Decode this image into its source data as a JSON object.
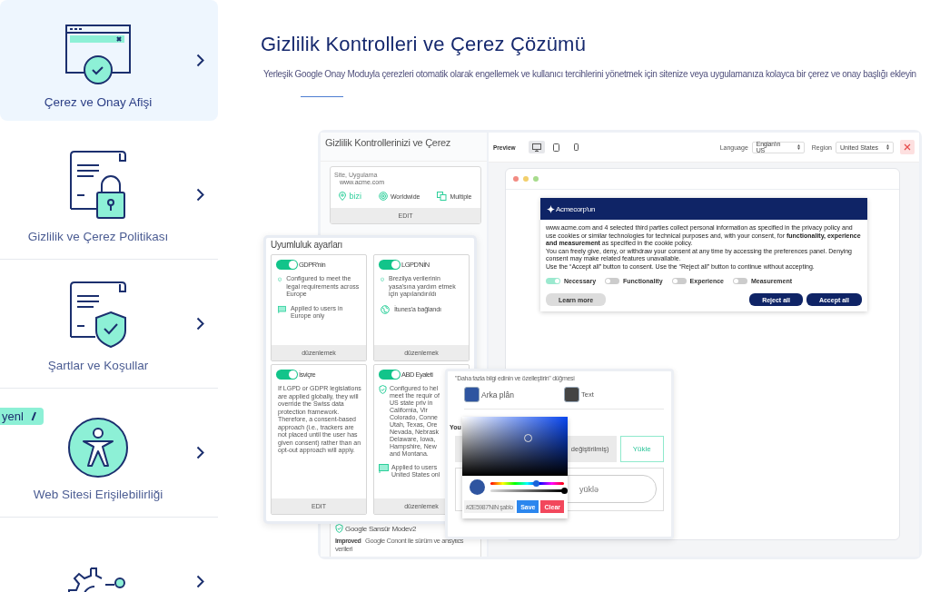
{
  "sidebar": {
    "items": [
      {
        "label": "Çerez ve Onay Afişi",
        "kind": "banner",
        "selected": true
      },
      {
        "label": "Gizlilik ve Çerez Politikası",
        "kind": "policy-lock",
        "selected": false
      },
      {
        "label": "Şartlar ve Koşullar",
        "kind": "policy-shield",
        "selected": false
      },
      {
        "label": "Web Sitesi Erişilebilirliği",
        "kind": "accessibility",
        "selected": false,
        "badge": "yenl"
      },
      {
        "kind": "gear-share",
        "selected": false
      }
    ]
  },
  "header": {
    "title": "Gizlilik Kontrolleri ve Çerez Çözümü",
    "subtitle": "Yerleşik Google Onay Moduyla çerezleri otomatik olarak engellemek ve kullanıcı tercihlerini yönetmek için sitenize veya uygulamanıza kolayca bir çerez ve onay başlığı ekleyin"
  },
  "config_panel": {
    "title": "Gizlilik Kontrollerinizi ve Çerez",
    "site_card": {
      "label": "Site, Uygulama",
      "url": "www.acme.com",
      "features": [
        {
          "kind": "pin",
          "label": "bizi"
        },
        {
          "kind": "target",
          "label": "Worldwide"
        },
        {
          "kind": "pages",
          "label": "Multiple"
        }
      ],
      "action": "EDIT"
    },
    "bottom_card": {
      "title": "Google Sansür Modev2",
      "tag": "Improved",
      "text": "Google Conont ile sürüm ve ansytics verileri"
    }
  },
  "toolbar": {
    "label": "Preview",
    "devices": [
      {
        "kind": "desktop",
        "selected": true
      },
      {
        "kind": "tablet",
        "selected": false
      },
      {
        "kind": "phone",
        "selected": false
      }
    ],
    "language_label": "Language",
    "language": "Engian'ın US",
    "region_label": "Region",
    "region": "United States"
  },
  "banner": {
    "brand": "Acmecorp'un",
    "paragraphs": [
      "www.acme.com and 4 selected third parties collect personal information as specified in the privacy policy and use cookies or similar technologies for technical purposes and, with your consent, for **functionality, experience and measurement** as specified in the cookie policy.",
      "You can freely give, deny, or withdraw your consent at any time by accessing the preferences panel. Denying consent may make related features unavailable.",
      "Use the “Accept all” button to consent. Use the “Reject all” button to continue without accepting."
    ],
    "toggles": [
      {
        "label": "Necessary",
        "on": true
      },
      {
        "label": "Functionality",
        "on": false
      },
      {
        "label": "Experience",
        "on": false
      },
      {
        "label": "Measurement",
        "on": false
      }
    ],
    "learn_more": "Learn more",
    "reject": "Reject all",
    "accept": "Accept all"
  },
  "compliance": {
    "title": "Uyumluluk ayarları",
    "cards": [
      {
        "title": "GDPR'nin",
        "on": true,
        "rows": [
          {
            "kind": "shield",
            "text": "Configured to meet the legal requirements across Europe"
          },
          {
            "kind": "flag",
            "text": "Applied to users in Europe only"
          }
        ],
        "action": "düzenlemek"
      },
      {
        "title": "LGPD'NİN",
        "on": true,
        "rows": [
          {
            "kind": "shield",
            "text": "Brezilya verilerinin yasa'sına yardım etmek için yapılandırıldı"
          },
          {
            "kind": "globe",
            "text": "İtunes'a bağlandı"
          }
        ],
        "action": "düzenlemek"
      },
      {
        "title": "İsviçre",
        "on": true,
        "rows": [
          {
            "kind": "note",
            "text": "If LGPD or GDPR legislations are applied globally, they will override the Swiss data protection framework. Therefore, a consent-based approach (i.e., trackers are not placed until the user has given consent) rather than an opt-out approach will apply."
          }
        ],
        "action": "EDIT"
      },
      {
        "title": "ABD Eyaleti",
        "on": true,
        "rows": [
          {
            "kind": "shield",
            "text": "Configured to hel meet the requir of US state priv in California, Vir Colorado, Conne Utah, Texas, Ore Nevada, Nebrask Delaware, Iowa, Hampshire, New and Montana."
          },
          {
            "kind": "flag",
            "text": "Applied to users United States onl"
          }
        ],
        "action": "düzenlemek"
      }
    ]
  },
  "color_panel": {
    "label": "\"Daha fazla bilgi edinin ve özelleştirin\" düğmesi",
    "swatches": [
      {
        "label": "Arka plân",
        "color": "#2f55a0"
      },
      {
        "label": "Text",
        "color": "#444444"
      }
    ],
    "section": "You",
    "changed_button": "değiştirilmiş)",
    "upload_button": "Yükle",
    "upload_field": "yüklə",
    "picker": {
      "hue": {
        "level": 0.62
      },
      "alpha": {
        "level": 1
      },
      "hex": "#2E5987'NIN şablo",
      "save": "Save",
      "clear": "Clear"
    }
  }
}
